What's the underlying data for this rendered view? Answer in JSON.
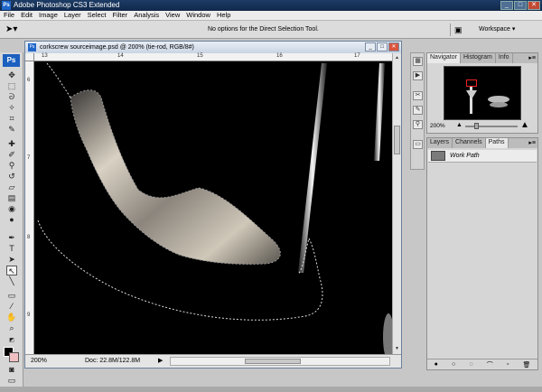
{
  "window": {
    "title": "Adobe Photoshop CS3 Extended",
    "app_badge": "Ps",
    "min": "_",
    "max": "□",
    "close": "✕"
  },
  "menu": [
    "File",
    "Edit",
    "Image",
    "Layer",
    "Select",
    "Filter",
    "Analysis",
    "View",
    "Window",
    "Help"
  ],
  "options_bar": {
    "message": "No options for the Direct Selection Tool.",
    "workspace_label": "Workspace ▾"
  },
  "document": {
    "title": "corkscrew sourceimage.psd @ 200% (tie-rod, RGB/8#)",
    "zoom": "200%",
    "doc_size": "Doc: 22.8M/122.8M",
    "ruler_top": [
      "13",
      "14",
      "15",
      "16",
      "17"
    ],
    "ruler_left": [
      "6",
      "7",
      "8",
      "9"
    ]
  },
  "toolbox": {
    "logo": "Ps"
  },
  "navigator": {
    "tabs": [
      "Navigator",
      "Histogram",
      "Info"
    ],
    "zoom": "200%"
  },
  "paths_panel": {
    "tabs": [
      "Layers",
      "Channels",
      "Paths"
    ],
    "paths": [
      {
        "name": "Work Path"
      }
    ]
  },
  "colors": {
    "foreground": "#000000",
    "background": "#f0bfc2",
    "canvas": "#000000"
  }
}
